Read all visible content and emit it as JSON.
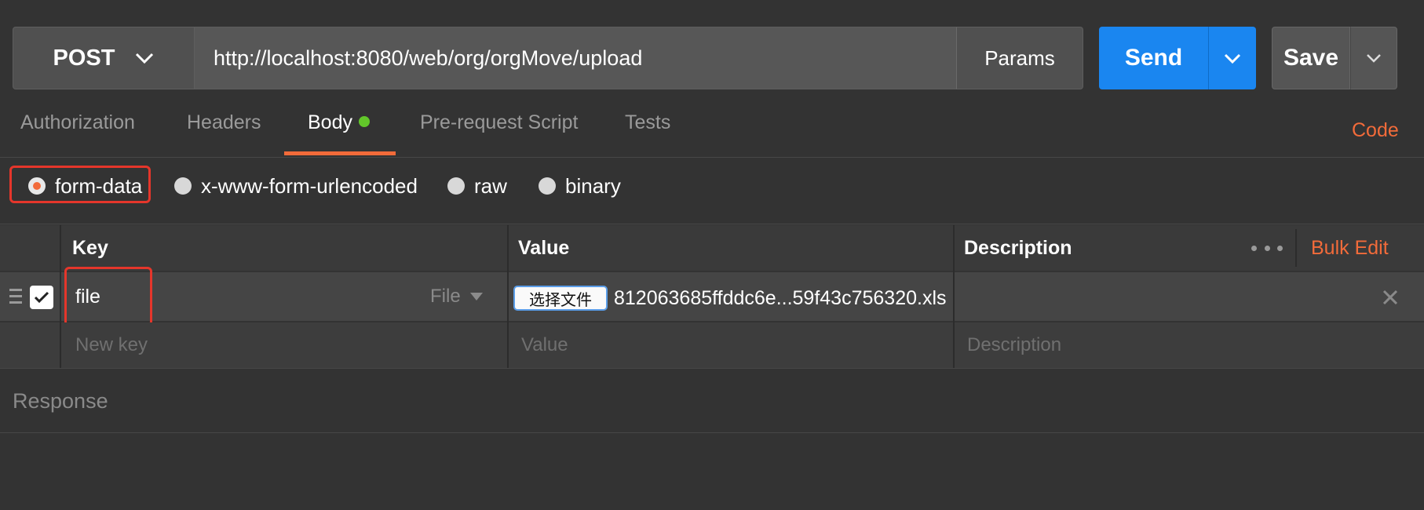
{
  "request": {
    "method": "POST",
    "url": "http://localhost:8080/web/org/orgMove/upload",
    "params_label": "Params",
    "send_label": "Send",
    "save_label": "Save"
  },
  "tabs": [
    {
      "label": "Authorization",
      "active": false
    },
    {
      "label": "Headers",
      "active": false
    },
    {
      "label": "Body",
      "active": true
    },
    {
      "label": "Pre-request Script",
      "active": false
    },
    {
      "label": "Tests",
      "active": false
    }
  ],
  "code_link": "Code",
  "body_types": [
    {
      "label": "form-data",
      "selected": true
    },
    {
      "label": "x-www-form-urlencoded",
      "selected": false
    },
    {
      "label": "raw",
      "selected": false
    },
    {
      "label": "binary",
      "selected": false
    }
  ],
  "table": {
    "headers": {
      "key": "Key",
      "value": "Value",
      "description": "Description"
    },
    "bulk_edit": "Bulk Edit",
    "rows": [
      {
        "checked": true,
        "key": "file",
        "type": "File",
        "choose_file_label": "选择文件",
        "file_name": "812063685ffddc6e...59f43c756320.xls"
      }
    ],
    "new_row": {
      "key_placeholder": "New key",
      "value_placeholder": "Value",
      "description_placeholder": "Description"
    }
  },
  "response_label": "Response",
  "colors": {
    "accent_orange": "#f26b3a",
    "send_blue": "#1a86f0",
    "body_dot_green": "#62c72a",
    "highlight_red": "#e5362b"
  }
}
